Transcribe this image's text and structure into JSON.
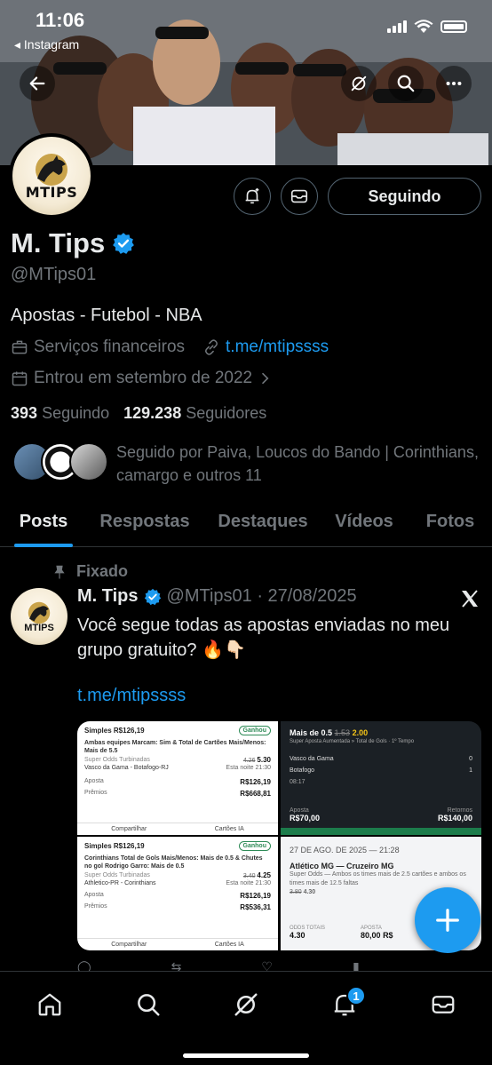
{
  "status_bar": {
    "time": "11:06",
    "back_app": "◂ Instagram"
  },
  "profile": {
    "name": "M. Tips",
    "handle": "@MTips01",
    "bio": "Apostas - Futebol - NBA",
    "category": "Serviços financeiros",
    "link": "t.me/mtipssss",
    "joined": "Entrou em setembro de 2022",
    "following_count": "393",
    "following_label": "Seguindo",
    "followers_count": "129.238",
    "followers_label": "Seguidores",
    "followed_by": "Seguido por Paiva, Loucos do Bando | Corinthians, camargo e outros 11",
    "follow_button": "Seguindo",
    "avatar_text": "MTIPS",
    "verified_color": "#1d9bf0"
  },
  "tabs": [
    {
      "label": "Posts",
      "active": true
    },
    {
      "label": "Respostas",
      "active": false
    },
    {
      "label": "Destaques",
      "active": false
    },
    {
      "label": "Vídeos",
      "active": false
    },
    {
      "label": "Fotos",
      "active": false
    }
  ],
  "post": {
    "pinned_label": "Fixado",
    "author": "M. Tips",
    "meta": "@MTips01 · 27/08/2025",
    "text": "Você segue todas as apostas enviadas no meu grupo gratuito? 🔥👇🏻",
    "link": "t.me/mtipssss",
    "media": {
      "ticket1": {
        "title": "Simples R$126,19",
        "badge": "Ganhou",
        "line": "Ambas equipes Marcam: Sim & Total de Cartões Mais/Menos: Mais de 5.5",
        "odds_old": "4.26",
        "odds": "5.30",
        "market": "Super Odds Turbinadas",
        "match": "Vasco da Gama - Botafogo-RJ",
        "time": "Esta noite 21:30",
        "stake_label": "Aposta",
        "stake": "R$126,19",
        "prize_label": "Prêmios",
        "prize": "R$668,81",
        "share": "Compartilhar",
        "cards": "Cartões IA"
      },
      "ticket2": {
        "odds_old": "1.53",
        "odds": "2.00",
        "line": "Mais de 0.5",
        "sub": "Super Aposta Aumentada » Total de Gols · 1º Tempo",
        "team1": "Vasco da Gama",
        "team2": "Botafogo",
        "score1": "0",
        "score2": "1",
        "clock": "08:17",
        "stake_label": "Aposta",
        "stake": "R$70,00",
        "returns_label": "Retornos",
        "returns": "R$140,00"
      },
      "ticket3": {
        "title": "Simples R$126,19",
        "badge": "Ganhou",
        "line": "Corinthians Total de Gols Mais/Menos: Mais de 0.5 & Chutes no gol Rodrigo Garro: Mais de 0.5",
        "odds_old": "3.40",
        "odds": "4.25",
        "market": "Super Odds Turbinadas",
        "match": "Athletico-PR - Corinthians",
        "time": "Esta noite 21:30",
        "stake_label": "Aposta",
        "stake": "R$126,19",
        "prize_label": "Prêmios",
        "prize": "R$536,31",
        "share": "Compartilhar",
        "cards": "Cartões IA"
      },
      "ticket4": {
        "date": "27 DE AGO. DE 2025 — 21:28",
        "match": "Atlético MG — Cruzeiro MG",
        "sub": "Super Odds — Ambos os times mais de 2.5 cartões e ambos os times mais de 12.5 faltas",
        "odds_old": "3.80",
        "odds": "4.30",
        "totals_label": "ODDS TOTAIS",
        "totals": "4.30",
        "stake_label": "APOSTA",
        "stake": "80,00",
        "currency": "R$"
      }
    }
  },
  "nav": {
    "notifications_badge": "1"
  },
  "colors": {
    "accent": "#1d9bf0",
    "muted": "#71767b",
    "text": "#e7e9ea",
    "background": "#000000"
  }
}
